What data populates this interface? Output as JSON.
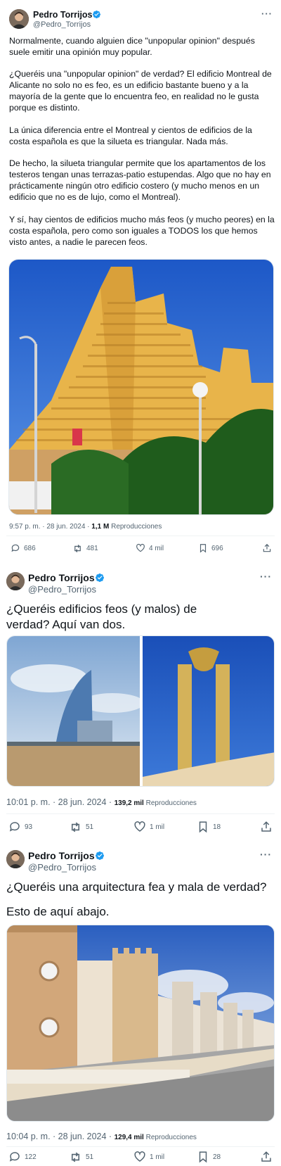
{
  "tweet1": {
    "name": "Pedro Torrijos",
    "handle": "@Pedro_Torrijos",
    "paragraphs": [
      "Normalmente, cuando alguien dice \"unpopular opinion\" después suele emitir una opinión muy popular.",
      "¿Queréis una \"unpopular opinion\" de verdad? El edificio Montreal de Alicante no solo no es feo, es un edificio bastante bueno y a la mayoría de la gente que lo encuentra feo, en realidad no le gusta porque es distinto.",
      "La única diferencia entre el Montreal y cientos de edificios de la costa española es que la silueta es triangular. Nada más.",
      "De hecho, la silueta triangular permite que los apartamentos de los testeros tengan unas terrazas-patio estupendas. Algo que no hay en prácticamente ningún otro edificio costero (y mucho menos en un edificio que no es de lujo, como el Montreal).",
      "Y sí, hay cientos de edificios mucho más feos (y mucho peores) en la costa española, pero como son iguales a TODOS los que hemos visto antes, a nadie le parecen feos."
    ],
    "time": "9:57 p. m. · 28 jun. 2024 · ",
    "views": "1,1 M",
    "views_label": " Reproducciones",
    "replies": "686",
    "retweets": "481",
    "likes": "4 mil",
    "bookmarks": "696"
  },
  "tweet2": {
    "name": "Pedro Torrijos",
    "handle": "@Pedro_Torrijos",
    "text": "¿Queréis edificios feos (y malos) de verdad? Aquí van dos.",
    "time": "10:01 p. m. · 28 jun. 2024 · ",
    "views": "139,2 mil",
    "views_label": " Reproducciones",
    "replies": "93",
    "retweets": "51",
    "likes": "1 mil",
    "bookmarks": "18"
  },
  "tweet3": {
    "name": "Pedro Torrijos",
    "handle": "@Pedro_Torrijos",
    "line1": "¿Queréis una arquitectura fea y mala de verdad?",
    "line2": "Esto de aquí abajo.",
    "time": "10:04 p. m. · 28 jun. 2024 · ",
    "views": "129,4 mil",
    "views_label": " Reproducciones",
    "replies": "122",
    "retweets": "51",
    "likes": "1 mil",
    "bookmarks": "28"
  },
  "icons": {
    "more": "more-icon",
    "verified": "verified-badge-icon",
    "reply": "reply-icon",
    "retweet": "retweet-icon",
    "like": "heart-icon",
    "bookmark": "bookmark-icon",
    "share": "share-icon"
  },
  "colors": {
    "verified": "#1d9bf0",
    "secondary_text": "#536471"
  }
}
